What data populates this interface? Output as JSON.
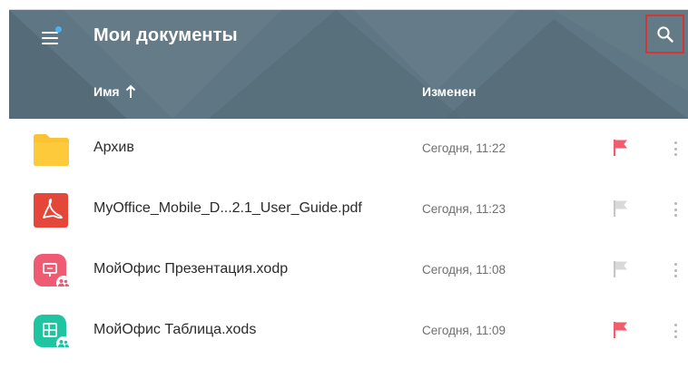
{
  "appbar": {
    "title": "Мои документы",
    "columns": {
      "name": "Имя",
      "name_sort": "ascending",
      "modified": "Изменен"
    }
  },
  "files": [
    {
      "name": "Архив",
      "modified": "Сегодня, 11:22",
      "icon": "folder-icon",
      "flagged": true
    },
    {
      "name": "MyOffice_Mobile_D...2.1_User_Guide.pdf",
      "modified": "Сегодня, 11:23",
      "icon": "pdf-icon",
      "flagged": false
    },
    {
      "name": "МойОфис Презентация.xodp",
      "modified": "Сегодня, 11:08",
      "icon": "presentation-icon",
      "flagged": false,
      "shared": true
    },
    {
      "name": "МойОфис Таблица.xods",
      "modified": "Сегодня, 11:09",
      "icon": "spreadsheet-icon",
      "flagged": true,
      "shared": true
    }
  ],
  "colors": {
    "appbar": "#5f7684",
    "flag_on": "#ef5d6e",
    "flag_off": "#c7c7c7",
    "folder": "#fbc232",
    "pdf": "#e4463a",
    "presentation": "#ee5b72",
    "spreadsheet": "#1fc4a0",
    "notification_dot": "#48b3f2"
  }
}
